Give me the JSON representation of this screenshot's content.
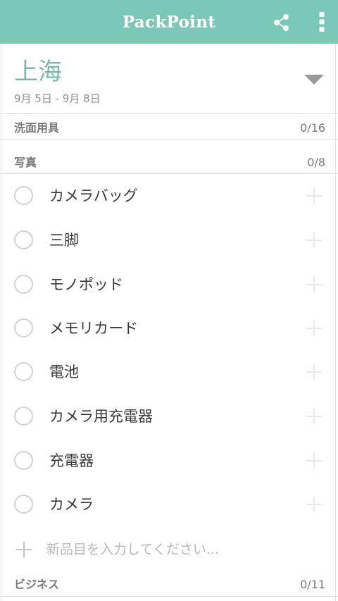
{
  "appbar": {
    "title": "PackPoint",
    "share_icon": "share-icon",
    "more_icon": "more-vert-icon",
    "color": "#7cc8b6"
  },
  "trip": {
    "name": "上海",
    "dates": "9月 5日 - 9月 8日",
    "caret_icon": "dropdown-caret-icon",
    "accent": "#7ab8aa"
  },
  "categories": [
    {
      "name": "洗面用具",
      "count": "0/16"
    },
    {
      "name": "写真",
      "count": "0/8"
    },
    {
      "name": "ビジネス",
      "count": "0/11"
    }
  ],
  "items": [
    {
      "label": "カメラバッグ"
    },
    {
      "label": "三脚"
    },
    {
      "label": "モノポッド"
    },
    {
      "label": "メモリカード"
    },
    {
      "label": "電池"
    },
    {
      "label": "カメラ用充電器"
    },
    {
      "label": "充電器"
    },
    {
      "label": "カメラ"
    }
  ],
  "new_item": {
    "placeholder": "新品目を入力してください..."
  }
}
